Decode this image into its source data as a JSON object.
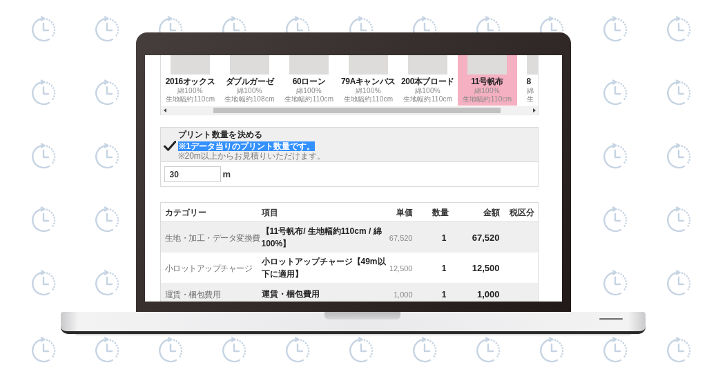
{
  "fabrics": {
    "items": [
      {
        "name": "2016オックス",
        "material": "綿100%",
        "width": "生地幅約110cm",
        "selected": false
      },
      {
        "name": "ダブルガーゼ",
        "material": "綿100%",
        "width": "生地幅約108cm",
        "selected": false
      },
      {
        "name": "60ローン",
        "material": "綿100%",
        "width": "生地幅約110cm",
        "selected": false
      },
      {
        "name": "79Aキャンバス",
        "material": "綿100%",
        "width": "生地幅約110cm",
        "selected": false
      },
      {
        "name": "200本ブロード",
        "material": "綿100%",
        "width": "生地幅約110cm",
        "selected": false
      },
      {
        "name": "11号帆布",
        "material": "綿100%",
        "width": "生地幅約110cm",
        "selected": true
      },
      {
        "name": "8",
        "material": "綿",
        "width": "生",
        "selected": false
      }
    ]
  },
  "quantity_section": {
    "title": "プリント数量を決める",
    "completed": true,
    "notes": [
      {
        "text": "※1データ当りのプリント数量です。",
        "highlighted": true
      },
      {
        "text": "※20m以上からお見積りいただけます。",
        "highlighted": false
      }
    ],
    "input": {
      "value": "30"
    },
    "unit": "m"
  },
  "table": {
    "columns": [
      "カテゴリー",
      "項目",
      "単価",
      "数量",
      "金額",
      "税区分"
    ],
    "rows": [
      {
        "category": "生地・加工・データ変換費",
        "item": "【11号帆布/ 生地幅約110cm / 綿100%】",
        "unit_price": "67,520",
        "quantity": "1",
        "amount": "67,520"
      },
      {
        "category": "小ロットアップチャージ",
        "item": "小ロットアップチャージ【49m以下に適用】",
        "unit_price": "12,500",
        "quantity": "1",
        "amount": "12,500"
      },
      {
        "category": "運賃・梱包費用",
        "item": "運賃・梱包費用",
        "unit_price": "1,000",
        "quantity": "1",
        "amount": "1,000"
      }
    ]
  }
}
